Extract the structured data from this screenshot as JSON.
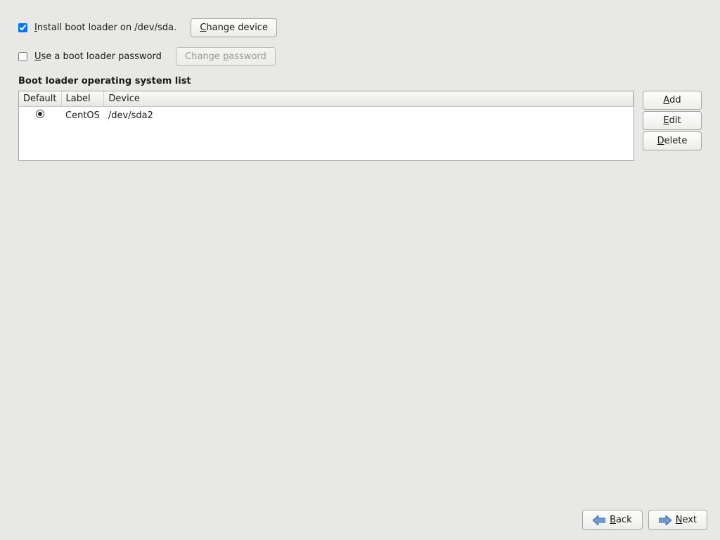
{
  "install_row": {
    "checked": true,
    "label_pre": "I",
    "label_rest": "nstall boot loader on /dev/sda.",
    "change_device_pre": "C",
    "change_device_rest": "hange device"
  },
  "password_row": {
    "checked": false,
    "label_pre": "U",
    "label_rest": "se a boot loader password",
    "change_password_pre": "p",
    "change_password_before": "Change ",
    "change_password_rest": "assword"
  },
  "os_list": {
    "heading": "Boot loader operating system list",
    "columns": {
      "default": "Default",
      "label": "Label",
      "device": "Device"
    },
    "rows": [
      {
        "default_selected": true,
        "label": "CentOS",
        "device": "/dev/sda2"
      }
    ]
  },
  "side_buttons": {
    "add_pre": "A",
    "add_rest": "dd",
    "edit_pre": "E",
    "edit_rest": "dit",
    "delete_pre": "D",
    "delete_rest": "elete"
  },
  "footer": {
    "back_pre": "B",
    "back_rest": "ack",
    "next_pre": "N",
    "next_rest": "ext"
  }
}
